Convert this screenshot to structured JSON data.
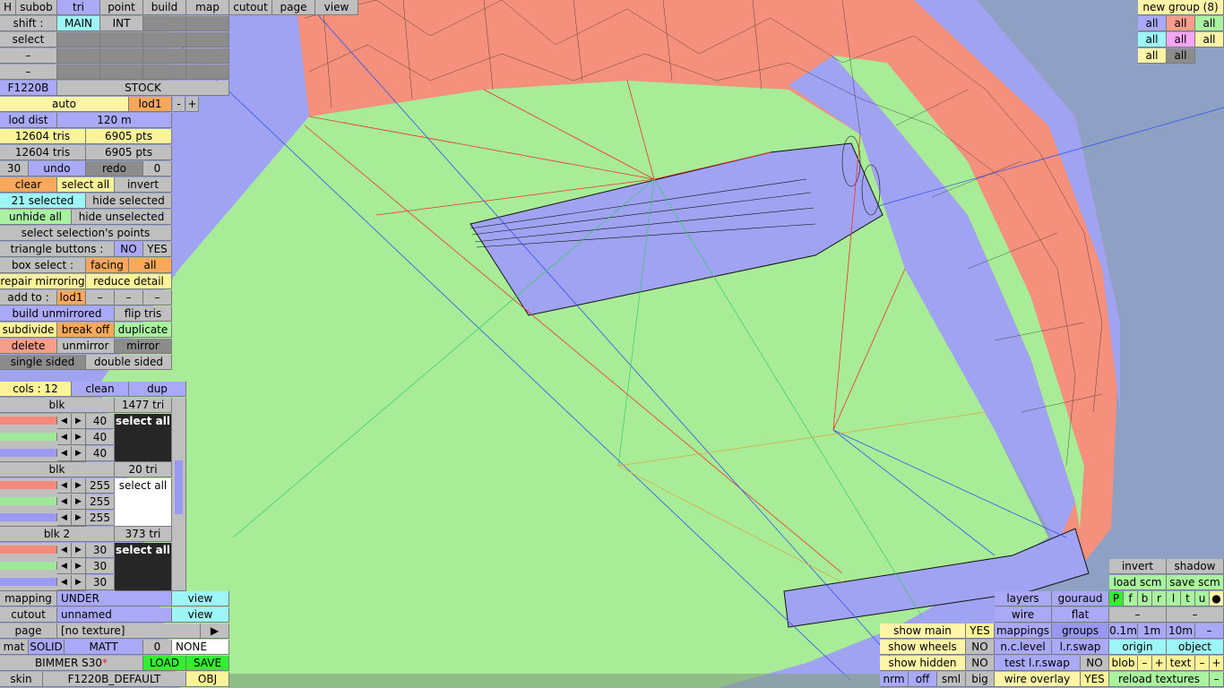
{
  "menu": [
    "H",
    "subob",
    "tri",
    "point",
    "build",
    "map",
    "cutout",
    "page",
    "view"
  ],
  "rows": {
    "shift": "shift :",
    "main": "MAIN",
    "int": "INT",
    "select": "select",
    "dash": "–",
    "f1220b": "F1220B",
    "stock": "STOCK",
    "auto": "auto",
    "lod1": "lod1",
    "minus": "-",
    "plus": "+",
    "lod_dist_label": "lod dist",
    "lod_dist_value": "120 m",
    "tris1": "12604 tris",
    "pts1": "6905 pts",
    "tris2": "12604 tris",
    "pts2": "6905 pts",
    "undo_count": "30",
    "undo": "undo",
    "redo": "redo",
    "redo_count": "0",
    "clear": "clear",
    "select_all": "select all",
    "invert": "invert",
    "selected": "21 selected",
    "hide_selected": "hide selected",
    "unhide_all": "unhide all",
    "hide_unselected": "hide unselected",
    "select_points": "select selection's points",
    "triangle_buttons": "triangle buttons :",
    "no": "NO",
    "yes": "YES",
    "box_select": "box select :",
    "facing": "facing",
    "all": "all",
    "repair_mirroring": "repair mirroring",
    "reduce_detail": "reduce detail",
    "add_to": "add to :",
    "add_lod1": "lod1",
    "build_unmirrored": "build unmirrored",
    "flip_tris": "flip tris",
    "subdivide": "subdivide",
    "break_off": "break off",
    "duplicate": "duplicate",
    "delete": "delete",
    "unmirror": "unmirror",
    "mirror": "mirror",
    "single_sided": "single sided",
    "double_sided": "double sided"
  },
  "colors_panel": {
    "cols": "cols : 12",
    "clean": "clean",
    "dup": "dup",
    "groups": [
      {
        "name": "blk",
        "tris": "1477 tri",
        "values": [
          "40",
          "40",
          "40"
        ],
        "sel": "select all"
      },
      {
        "name": "blk",
        "tris": "20 tri",
        "values": [
          "255",
          "255",
          "255"
        ],
        "sel": "select all"
      },
      {
        "name": "blk 2",
        "tris": "373 tri",
        "values": [
          "30",
          "30",
          "30"
        ],
        "sel": "select all"
      }
    ]
  },
  "bottom_left": {
    "mapping": "mapping",
    "under": "UNDER",
    "view": "view",
    "cutout": "cutout",
    "unnamed": "unnamed",
    "page": "page",
    "no_texture": "[no texture]",
    "arrow": "▶",
    "mat": "mat",
    "solid": "SOLID",
    "matt": "MATT",
    "zero": "0",
    "none": "NONE",
    "car_name": "BIMMER S30",
    "star": "*",
    "load": "LOAD",
    "save": "SAVE",
    "skin": "skin",
    "skin_name": "F1220B_DEFAULT",
    "obj": "OBJ"
  },
  "top_right": {
    "new_group": "new group (8)",
    "all": "all"
  },
  "bottom_right": {
    "invert": "invert",
    "shadow": "shadow",
    "load_scm": "load scm",
    "save_scm": "save scm",
    "layers": "layers",
    "gouraud": "gouraud",
    "letters": [
      "P",
      "f",
      "b",
      "r",
      "l",
      "t",
      "u",
      "●"
    ],
    "wire": "wire",
    "flat": "flat",
    "show_main": "show main",
    "yes": "YES",
    "mappings": "mappings",
    "groups": "groups",
    "d01": "0.1m",
    "d1": "1m",
    "d10": "10m",
    "dash": "–",
    "show_wheels": "show wheels",
    "no": "NO",
    "nc_level": "n.c.level",
    "lr_swap": "l.r.swap",
    "origin": "origin",
    "object": "object",
    "show_hidden": "show hidden",
    "test_lr_swap": "test l.r.swap",
    "blob": "blob",
    "minus": "–",
    "plus": "+",
    "text": "text",
    "nrm": "nrm",
    "off": "off",
    "sml": "sml",
    "big": "big",
    "wire_overlay": "wire overlay",
    "reload_textures": "reload textures"
  }
}
